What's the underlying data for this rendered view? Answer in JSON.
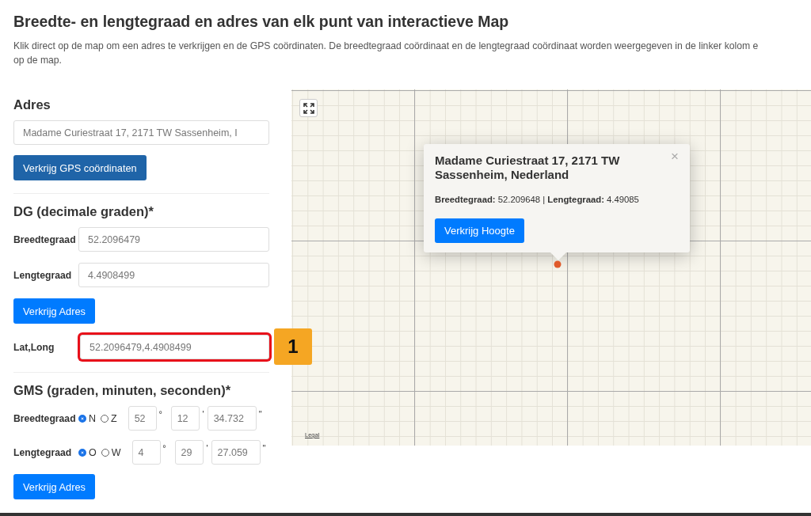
{
  "page": {
    "title": "Breedte- en lengtegraad en adres van elk punt van interactieve Map",
    "description_lines": [
      "Klik direct op de map om een adres te verkrijgen en de GPS coördinaten. De breedtegraad coördinaat en de lengtegraad coördinaat worden weergegeven in de linker kolom e",
      "op de map."
    ]
  },
  "address": {
    "heading": "Adres",
    "value": "Madame Curiestraat 17, 2171 TW Sassenheim, I",
    "button": "Verkrijg GPS coördinaten"
  },
  "dg": {
    "heading": "DG (decimale graden)*",
    "fields": [
      {
        "label": "Breedtegraad",
        "value": "52.2096479"
      },
      {
        "label": "Lengtegraad",
        "value": "4.4908499"
      }
    ],
    "button": "Verkrijg Adres",
    "latlong": {
      "label": "Lat,Long",
      "value": "52.2096479,4.4908499",
      "highlighted": true,
      "annotation": "1"
    }
  },
  "gms": {
    "heading": "GMS (graden, minuten, seconden)*",
    "rows": [
      {
        "label": "Breedtegraad",
        "options": [
          {
            "label": "N",
            "selected": true
          },
          {
            "label": "Z",
            "selected": false
          }
        ],
        "degrees": "52",
        "degree_sign": "°",
        "minutes": "12",
        "minute_sign": "'",
        "seconds": "34.732",
        "second_sign": "\""
      },
      {
        "label": "Lengtegraad",
        "options": [
          {
            "label": "O",
            "selected": true
          },
          {
            "label": "W",
            "selected": false
          }
        ],
        "degrees": "4",
        "degree_sign": "°",
        "minutes": "29",
        "minute_sign": "'",
        "seconds": "27.059",
        "second_sign": "\""
      }
    ],
    "button": "Verkrijg Adres"
  },
  "map": {
    "popup": {
      "title": "Madame Curiestraat 17, 2171 TW Sassenheim, Nederland",
      "info": "**Breedtegraad:** 52.209648 | **Lengtegraad:** 4.49085",
      "close": "×",
      "button": "Verkrijg Hoogte"
    },
    "legal": "Legal"
  }
}
